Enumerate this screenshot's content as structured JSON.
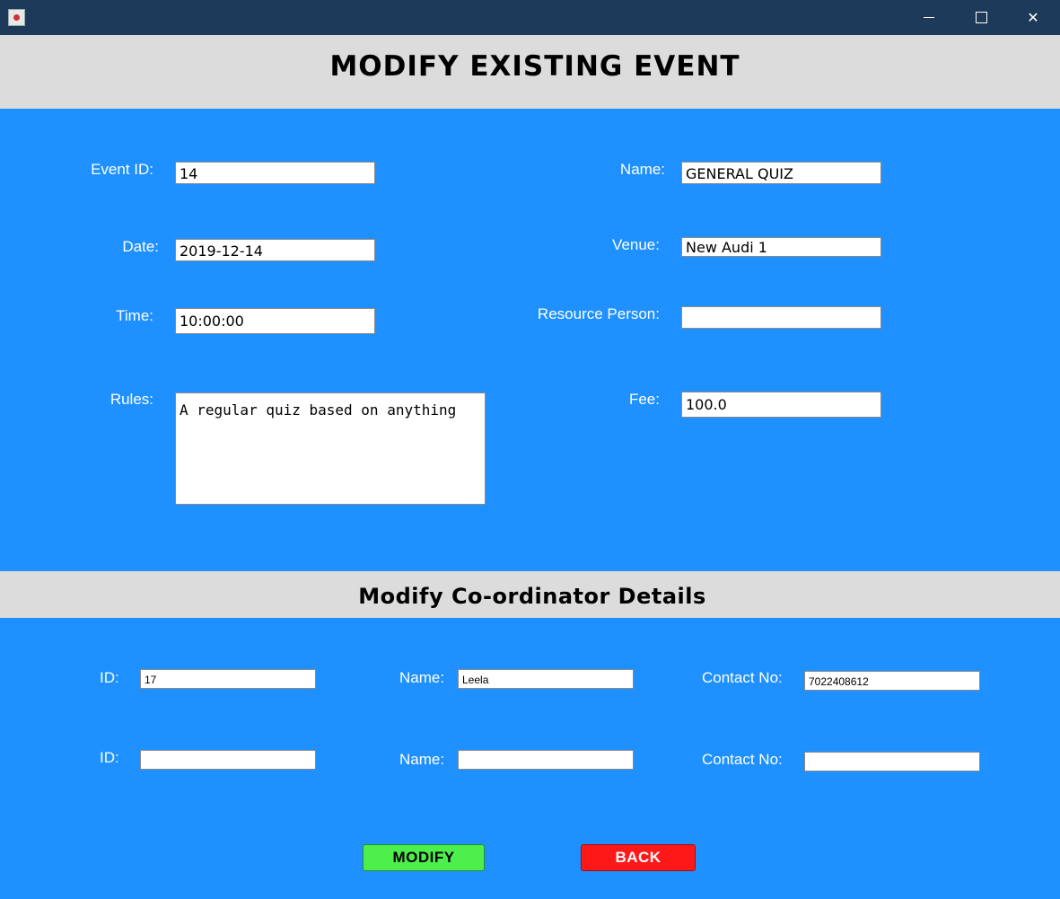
{
  "window": {
    "app_icon": "java-cup-icon",
    "minimize_glyph": "",
    "maximize_glyph": "",
    "close_glyph": "✕"
  },
  "header": {
    "title": "MODIFY EXISTING EVENT"
  },
  "event": {
    "event_id_label": "Event ID:",
    "event_id": "14",
    "name_label": "Name:",
    "name": "GENERAL QUIZ",
    "date_label": "Date:",
    "date": "2019-12-14",
    "venue_label": "Venue:",
    "venue": "New Audi 1",
    "time_label": "Time:",
    "time": "10:00:00",
    "resource_person_label": "Resource Person:",
    "resource_person": "",
    "rules_label": "Rules:",
    "rules": "A regular quiz based on anything",
    "fee_label": "Fee:",
    "fee": "100.0"
  },
  "coordinators": {
    "section_title": "Modify Co-ordinator Details",
    "id_label": "ID:",
    "name_label": "Name:",
    "contact_label": "Contact No:",
    "rows": [
      {
        "id": "17",
        "name": "Leela",
        "contact": "7022408612"
      },
      {
        "id": "",
        "name": "",
        "contact": ""
      }
    ]
  },
  "actions": {
    "modify_label": "MODIFY",
    "back_label": "BACK"
  },
  "colors": {
    "background": "#1e90ff",
    "band": "#dcdcdc",
    "titlebar": "#1d3a5a",
    "modify": "#4cef4c",
    "back": "#ff1818"
  }
}
